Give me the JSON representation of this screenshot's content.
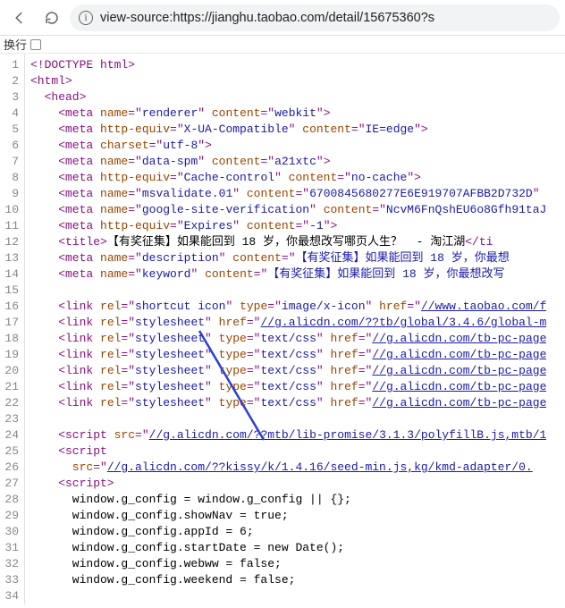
{
  "toolbar": {
    "back_icon": "back",
    "reload_icon": "reload",
    "info_icon_text": "i"
  },
  "addressBar": {
    "url": "view-source:https://jianghu.taobao.com/detail/15675360?s"
  },
  "subbar": {
    "label": "换行"
  },
  "gutter": {
    "start": 1,
    "end": 34
  },
  "source": {
    "lines": [
      {
        "t": "<!DOCTYPE html>",
        "cls": "p"
      },
      {
        "t": "<html>",
        "cls": "p"
      },
      {
        "t": "<head>",
        "cls": "p",
        "indent": 1
      },
      {
        "indent": 2,
        "parts": [
          {
            "c": "p",
            "t": "<meta "
          },
          {
            "c": "an",
            "t": "name"
          },
          {
            "c": "p",
            "t": "=\""
          },
          {
            "c": "av",
            "t": "renderer"
          },
          {
            "c": "p",
            "t": "\" "
          },
          {
            "c": "an",
            "t": "content"
          },
          {
            "c": "p",
            "t": "=\""
          },
          {
            "c": "av",
            "t": "webkit"
          },
          {
            "c": "p",
            "t": "\">"
          }
        ]
      },
      {
        "indent": 2,
        "parts": [
          {
            "c": "p",
            "t": "<meta "
          },
          {
            "c": "an",
            "t": "http-equiv"
          },
          {
            "c": "p",
            "t": "=\""
          },
          {
            "c": "av",
            "t": "X-UA-Compatible"
          },
          {
            "c": "p",
            "t": "\" "
          },
          {
            "c": "an",
            "t": "content"
          },
          {
            "c": "p",
            "t": "=\""
          },
          {
            "c": "av",
            "t": "IE=edge"
          },
          {
            "c": "p",
            "t": "\">"
          }
        ]
      },
      {
        "indent": 2,
        "parts": [
          {
            "c": "p",
            "t": "<meta "
          },
          {
            "c": "an",
            "t": "charset"
          },
          {
            "c": "p",
            "t": "=\""
          },
          {
            "c": "av",
            "t": "utf-8"
          },
          {
            "c": "p",
            "t": "\">"
          }
        ]
      },
      {
        "indent": 2,
        "parts": [
          {
            "c": "p",
            "t": "<meta "
          },
          {
            "c": "an",
            "t": "name"
          },
          {
            "c": "p",
            "t": "=\""
          },
          {
            "c": "av",
            "t": "data-spm"
          },
          {
            "c": "p",
            "t": "\" "
          },
          {
            "c": "an",
            "t": "content"
          },
          {
            "c": "p",
            "t": "=\""
          },
          {
            "c": "av",
            "t": "a21xtc"
          },
          {
            "c": "p",
            "t": "\">"
          }
        ]
      },
      {
        "indent": 2,
        "parts": [
          {
            "c": "p",
            "t": "<meta "
          },
          {
            "c": "an",
            "t": "http-equiv"
          },
          {
            "c": "p",
            "t": "=\""
          },
          {
            "c": "av",
            "t": "Cache-control"
          },
          {
            "c": "p",
            "t": "\" "
          },
          {
            "c": "an",
            "t": "content"
          },
          {
            "c": "p",
            "t": "=\""
          },
          {
            "c": "av",
            "t": "no-cache"
          },
          {
            "c": "p",
            "t": "\">"
          }
        ]
      },
      {
        "indent": 2,
        "parts": [
          {
            "c": "p",
            "t": "<meta "
          },
          {
            "c": "an",
            "t": "name"
          },
          {
            "c": "p",
            "t": "=\""
          },
          {
            "c": "av",
            "t": "msvalidate.01"
          },
          {
            "c": "p",
            "t": "\" "
          },
          {
            "c": "an",
            "t": "content"
          },
          {
            "c": "p",
            "t": "=\""
          },
          {
            "c": "av",
            "t": "6700845680277E6E919707AFBB2D732D"
          },
          {
            "c": "p",
            "t": "\""
          }
        ]
      },
      {
        "indent": 2,
        "parts": [
          {
            "c": "p",
            "t": "<meta "
          },
          {
            "c": "an",
            "t": "name"
          },
          {
            "c": "p",
            "t": "=\""
          },
          {
            "c": "av",
            "t": "google-site-verification"
          },
          {
            "c": "p",
            "t": "\" "
          },
          {
            "c": "an",
            "t": "content"
          },
          {
            "c": "p",
            "t": "=\""
          },
          {
            "c": "av",
            "t": "NcvM6FnQshEU6o8Gfh91taJ"
          }
        ]
      },
      {
        "indent": 2,
        "parts": [
          {
            "c": "p",
            "t": "<meta "
          },
          {
            "c": "an",
            "t": "http-equiv"
          },
          {
            "c": "p",
            "t": "=\""
          },
          {
            "c": "av",
            "t": "Expires"
          },
          {
            "c": "p",
            "t": "\" "
          },
          {
            "c": "an",
            "t": "content"
          },
          {
            "c": "p",
            "t": "=\""
          },
          {
            "c": "av",
            "t": "-1"
          },
          {
            "c": "p",
            "t": "\">"
          }
        ]
      },
      {
        "indent": 2,
        "parts": [
          {
            "c": "p",
            "t": "<title>"
          },
          {
            "c": "tx",
            "t": "【有奖征集】如果能回到 18 岁，你最想改写哪页人生？  - 淘江湖"
          },
          {
            "c": "p",
            "t": "</ti"
          }
        ]
      },
      {
        "indent": 2,
        "parts": [
          {
            "c": "p",
            "t": "<meta "
          },
          {
            "c": "an",
            "t": "name"
          },
          {
            "c": "p",
            "t": "=\""
          },
          {
            "c": "av",
            "t": "description"
          },
          {
            "c": "p",
            "t": "\" "
          },
          {
            "c": "an",
            "t": "content"
          },
          {
            "c": "p",
            "t": "=\""
          },
          {
            "c": "av",
            "t": "【有奖征集】如果能回到 18 岁，你最想"
          }
        ]
      },
      {
        "indent": 2,
        "parts": [
          {
            "c": "p",
            "t": "<meta "
          },
          {
            "c": "an",
            "t": "name"
          },
          {
            "c": "p",
            "t": "=\""
          },
          {
            "c": "av",
            "t": "keyword"
          },
          {
            "c": "p",
            "t": "\" "
          },
          {
            "c": "an",
            "t": "content"
          },
          {
            "c": "p",
            "t": "=\""
          },
          {
            "c": "av",
            "t": "【有奖征集】如果能回到 18 岁，你最想改写"
          }
        ]
      },
      {
        "t": "",
        "cls": "tx"
      },
      {
        "indent": 2,
        "parts": [
          {
            "c": "p",
            "t": "<link "
          },
          {
            "c": "an",
            "t": "rel"
          },
          {
            "c": "p",
            "t": "=\""
          },
          {
            "c": "av",
            "t": "shortcut icon"
          },
          {
            "c": "p",
            "t": "\" "
          },
          {
            "c": "an",
            "t": "type"
          },
          {
            "c": "p",
            "t": "=\""
          },
          {
            "c": "av",
            "t": "image/x-icon"
          },
          {
            "c": "p",
            "t": "\" "
          },
          {
            "c": "an",
            "t": "href"
          },
          {
            "c": "p",
            "t": "=\""
          },
          {
            "c": "lk",
            "t": "//www.taobao.com/f"
          }
        ]
      },
      {
        "indent": 2,
        "parts": [
          {
            "c": "p",
            "t": "<link "
          },
          {
            "c": "an",
            "t": "rel"
          },
          {
            "c": "p",
            "t": "=\""
          },
          {
            "c": "av",
            "t": "stylesheet"
          },
          {
            "c": "p",
            "t": "\" "
          },
          {
            "c": "an",
            "t": "href"
          },
          {
            "c": "p",
            "t": "=\""
          },
          {
            "c": "lk",
            "t": "//g.alicdn.com/??tb/global/3.4.6/global-m"
          }
        ]
      },
      {
        "indent": 2,
        "parts": [
          {
            "c": "p",
            "t": "<link "
          },
          {
            "c": "an",
            "t": "rel"
          },
          {
            "c": "p",
            "t": "=\""
          },
          {
            "c": "av",
            "t": "stylesheet"
          },
          {
            "c": "p",
            "t": "\" "
          },
          {
            "c": "an",
            "t": "type"
          },
          {
            "c": "p",
            "t": "=\""
          },
          {
            "c": "av",
            "t": "text/css"
          },
          {
            "c": "p",
            "t": "\" "
          },
          {
            "c": "an",
            "t": "href"
          },
          {
            "c": "p",
            "t": "=\""
          },
          {
            "c": "lk",
            "t": "//g.alicdn.com/tb-pc-page"
          }
        ]
      },
      {
        "indent": 2,
        "parts": [
          {
            "c": "p",
            "t": "<link "
          },
          {
            "c": "an",
            "t": "rel"
          },
          {
            "c": "p",
            "t": "=\""
          },
          {
            "c": "av",
            "t": "stylesheet"
          },
          {
            "c": "p",
            "t": "\" "
          },
          {
            "c": "an",
            "t": "type"
          },
          {
            "c": "p",
            "t": "=\""
          },
          {
            "c": "av",
            "t": "text/css"
          },
          {
            "c": "p",
            "t": "\" "
          },
          {
            "c": "an",
            "t": "href"
          },
          {
            "c": "p",
            "t": "=\""
          },
          {
            "c": "lk",
            "t": "//g.alicdn.com/tb-pc-page"
          }
        ]
      },
      {
        "indent": 2,
        "parts": [
          {
            "c": "p",
            "t": "<link "
          },
          {
            "c": "an",
            "t": "rel"
          },
          {
            "c": "p",
            "t": "=\""
          },
          {
            "c": "av",
            "t": "stylesheet"
          },
          {
            "c": "p",
            "t": "\" "
          },
          {
            "c": "an",
            "t": "type"
          },
          {
            "c": "p",
            "t": "=\""
          },
          {
            "c": "av",
            "t": "text/css"
          },
          {
            "c": "p",
            "t": "\" "
          },
          {
            "c": "an",
            "t": "href"
          },
          {
            "c": "p",
            "t": "=\""
          },
          {
            "c": "lk",
            "t": "//g.alicdn.com/tb-pc-page"
          }
        ]
      },
      {
        "indent": 2,
        "parts": [
          {
            "c": "p",
            "t": "<link "
          },
          {
            "c": "an",
            "t": "rel"
          },
          {
            "c": "p",
            "t": "=\""
          },
          {
            "c": "av",
            "t": "stylesheet"
          },
          {
            "c": "p",
            "t": "\" "
          },
          {
            "c": "an",
            "t": "type"
          },
          {
            "c": "p",
            "t": "=\""
          },
          {
            "c": "av",
            "t": "text/css"
          },
          {
            "c": "p",
            "t": "\" "
          },
          {
            "c": "an",
            "t": "href"
          },
          {
            "c": "p",
            "t": "=\""
          },
          {
            "c": "lk",
            "t": "//g.alicdn.com/tb-pc-page"
          }
        ]
      },
      {
        "indent": 2,
        "parts": [
          {
            "c": "p",
            "t": "<link "
          },
          {
            "c": "an",
            "t": "rel"
          },
          {
            "c": "p",
            "t": "=\""
          },
          {
            "c": "av",
            "t": "stylesheet"
          },
          {
            "c": "p",
            "t": "\" "
          },
          {
            "c": "an",
            "t": "type"
          },
          {
            "c": "p",
            "t": "=\""
          },
          {
            "c": "av",
            "t": "text/css"
          },
          {
            "c": "p",
            "t": "\" "
          },
          {
            "c": "an",
            "t": "href"
          },
          {
            "c": "p",
            "t": "=\""
          },
          {
            "c": "lk",
            "t": "//g.alicdn.com/tb-pc-page"
          }
        ]
      },
      {
        "t": "",
        "cls": "tx"
      },
      {
        "indent": 2,
        "parts": [
          {
            "c": "p",
            "t": "<script "
          },
          {
            "c": "an",
            "t": "src"
          },
          {
            "c": "p",
            "t": "=\""
          },
          {
            "c": "lk",
            "t": "//g.alicdn.com/??mtb/lib-promise/3.1.3/polyfillB.js,mtb/1"
          }
        ]
      },
      {
        "indent": 2,
        "parts": [
          {
            "c": "p",
            "t": "<script"
          }
        ]
      },
      {
        "indent": 3,
        "parts": [
          {
            "c": "an",
            "t": "src"
          },
          {
            "c": "p",
            "t": "=\""
          },
          {
            "c": "lk",
            "t": "//g.alicdn.com/??kissy/k/1.4.16/seed-min.js,kg/kmd-adapter/0."
          }
        ]
      },
      {
        "indent": 2,
        "parts": [
          {
            "c": "p",
            "t": "<script>"
          }
        ]
      },
      {
        "indent": 3,
        "parts": [
          {
            "c": "tx",
            "t": "window.g_config = window.g_config || {};"
          }
        ]
      },
      {
        "indent": 3,
        "parts": [
          {
            "c": "tx",
            "t": "window.g_config.showNav = true;"
          }
        ]
      },
      {
        "indent": 3,
        "parts": [
          {
            "c": "tx",
            "t": "window.g_config.appId = 6;"
          }
        ]
      },
      {
        "indent": 3,
        "parts": [
          {
            "c": "tx",
            "t": "window.g_config.startDate = new Date();"
          }
        ]
      },
      {
        "indent": 3,
        "parts": [
          {
            "c": "tx",
            "t": "window.g_config.webww = false;"
          }
        ]
      },
      {
        "indent": 3,
        "parts": [
          {
            "c": "tx",
            "t": "window.g_config.weekend = false;"
          }
        ]
      }
    ]
  }
}
